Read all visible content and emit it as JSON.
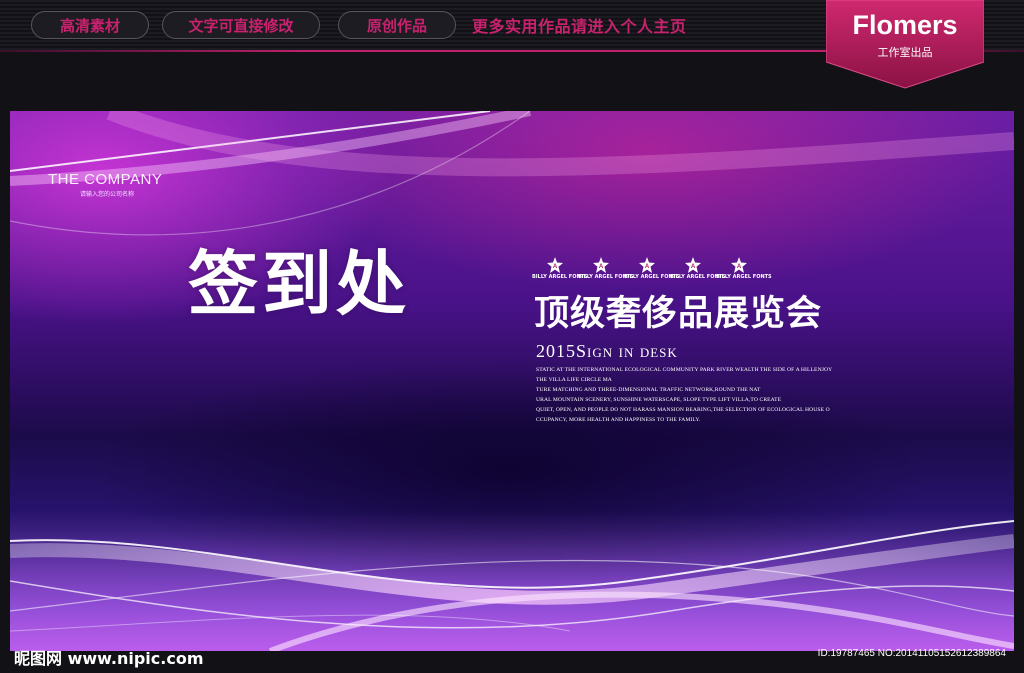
{
  "header": {
    "pills": [
      "高清素材",
      "文字可直接修改",
      "原创作品"
    ],
    "promo": "更多实用作品请进入个人主页"
  },
  "brand": {
    "name": "Flomers",
    "sub": "工作室出品"
  },
  "banner": {
    "company": "THE COMPANY",
    "company_sub": "请输入您的公司名称",
    "main_title": "签到处",
    "badge_letter": "A",
    "badge_label": "BILLY ARGEL FONTS",
    "subtitle": "顶级奢侈品展览会",
    "sign_line": "2015Sign in desk",
    "description": [
      "STATIC AT THE INTERNATIONAL ECOLOGICAL COMMUNITY PARK RIVER WEALTH THE SIDE OF A HILLENJOY",
      "THE VILLA LIFE CIRCLE MA",
      "TURE MATCHING AND THREE-DIMENSIONAL TRAFFIC NETWORK,ROUND THE NAT",
      "URAL MOUNTAIN SCENERY, SUNSHINE WATERSCAPE, SLOPE TYPE LIFT VILLA,TO CREATE",
      "QUIET, OPEN, AND PEOPLE DO NOT HARASS MANSION BEARING,THE SELECTION OF ECOLOGICAL HOUSE O",
      "CCUPANCY, MORE HEALTH AND HAPPINESS TO THE FAMILY."
    ]
  },
  "watermark": {
    "left": "昵图网 www.nipic.com",
    "right": "ID:19787465 NO:20141105152612389864"
  },
  "colors": {
    "accent": "#c8226e",
    "badge": "#b01a5c"
  }
}
